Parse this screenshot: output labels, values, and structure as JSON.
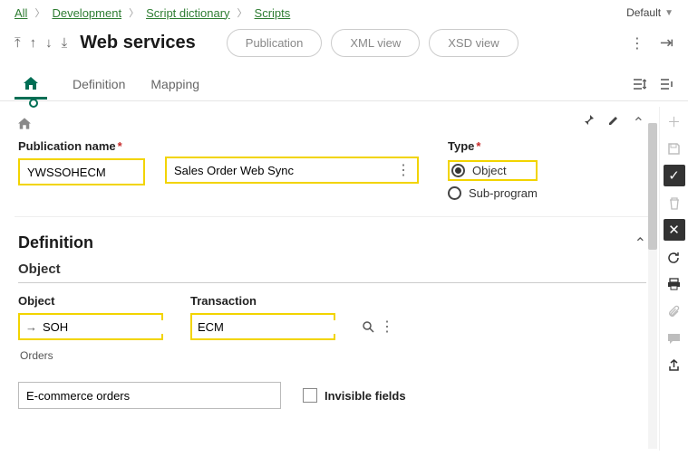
{
  "breadcrumb": {
    "all": "All",
    "dev": "Development",
    "dict": "Script dictionary",
    "scripts": "Scripts"
  },
  "top_right": {
    "default": "Default"
  },
  "title": "Web services",
  "pill": {
    "pub": "Publication",
    "xml": "XML view",
    "xsd": "XSD view"
  },
  "tabs": {
    "definition": "Definition",
    "mapping": "Mapping"
  },
  "form": {
    "pubname_label": "Publication name",
    "pubname_value": "YWSSOHECM",
    "pubdesc_value": "Sales Order Web Sync",
    "type_label": "Type",
    "type_object": "Object",
    "type_subprogram": "Sub-program"
  },
  "definition": {
    "heading": "Definition",
    "object_sub": "Object",
    "object_label": "Object",
    "object_value": "SOH",
    "object_helper": "Orders",
    "transaction_label": "Transaction",
    "transaction_value": "ECM"
  },
  "bottom": {
    "ecom_value": "E-commerce orders",
    "invisible_label": "Invisible fields"
  }
}
